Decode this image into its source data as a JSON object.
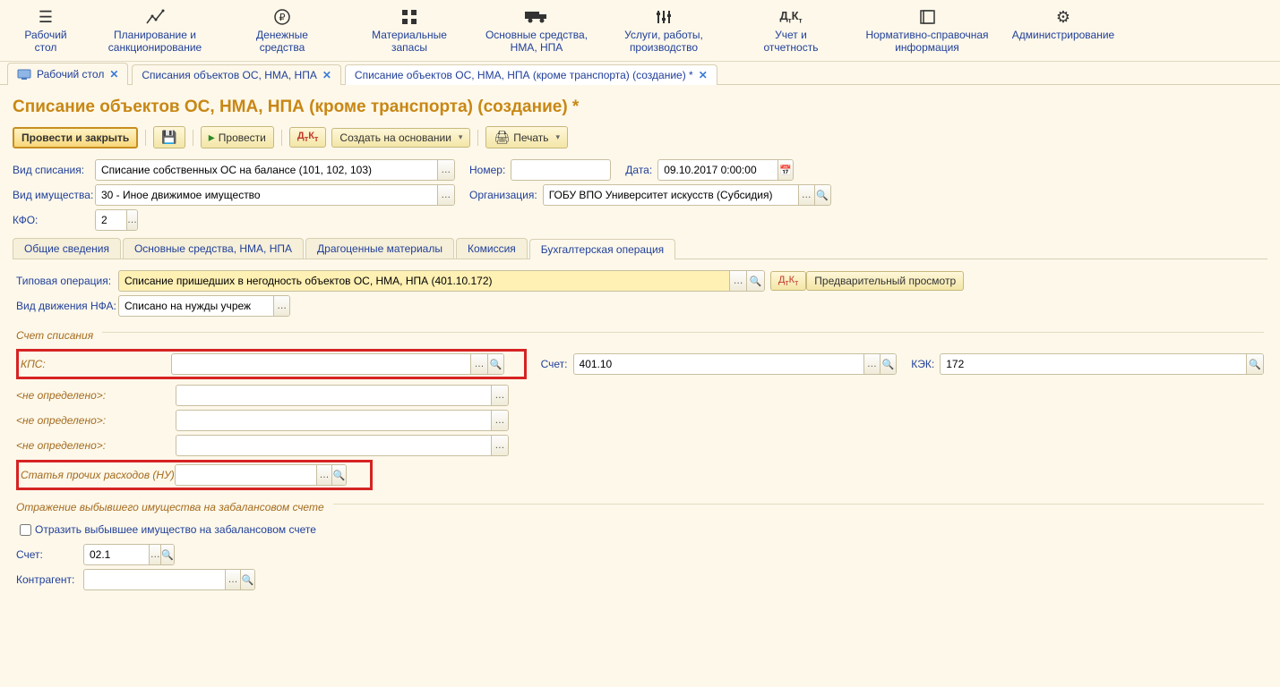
{
  "nav": [
    {
      "label": "Рабочий\nстол"
    },
    {
      "label": "Планирование и\nсанкционирование"
    },
    {
      "label": "Денежные\nсредства"
    },
    {
      "label": "Материальные\nзапасы"
    },
    {
      "label": "Основные средства,\nНМА, НПА"
    },
    {
      "label": "Услуги, работы,\nпроизводство"
    },
    {
      "label": "Учет и\nотчетность"
    },
    {
      "label": "Нормативно-справочная\nинформация"
    },
    {
      "label": "Администрирование"
    }
  ],
  "tabs": [
    {
      "label": "Рабочий стол"
    },
    {
      "label": "Списания объектов ОС, НМА, НПА"
    },
    {
      "label": "Списание объектов ОС, НМА, НПА (кроме транспорта) (создание) *",
      "active": true
    }
  ],
  "page_title": "Списание объектов ОС, НМА, НПА (кроме транспорта) (создание) *",
  "toolbar": {
    "post_close": "Провести и закрыть",
    "post": "Провести",
    "create_on_basis": "Создать на основании",
    "print": "Печать"
  },
  "fields": {
    "type_label": "Вид списания:",
    "type_value": "Списание собственных ОС на балансе (101, 102, 103)",
    "number_label": "Номер:",
    "number_value": "",
    "date_label": "Дата:",
    "date_value": "09.10.2017 0:00:00",
    "property_label": "Вид имущества:",
    "property_value": "30 - Иное движимое имущество",
    "org_label": "Организация:",
    "org_value": "ГОБУ ВПО Университет искусств (Субсидия)",
    "kfo_label": "КФО:",
    "kfo_value": "2"
  },
  "subtabs": [
    "Общие сведения",
    "Основные средства, НМА, НПА",
    "Драгоценные материалы",
    "Комиссия",
    "Бухгалтерская операция"
  ],
  "subtab_active": 4,
  "acc_op": {
    "type_label": "Типовая операция:",
    "type_value": "Списание пришедших в негодность объектов ОС, НМА, НПА (401.10.172)",
    "preview": "Предварительный просмотр",
    "nfa_label": "Вид движения НФА:",
    "nfa_value": "Списано на нужды учреж",
    "fs1_title": "Счет списания",
    "kps_label": "КПС:",
    "kps_value": "",
    "acct_label": "Счет:",
    "acct_value": "401.10",
    "kek_label": "КЭК:",
    "kek_value": "172",
    "nd": "<не определено>:",
    "expense_label": "Статья прочих расходов (НУ):",
    "expense_value": "",
    "fs2_title": "Отражение выбывшего имущества на забалансовом счете",
    "reflect_label": "Отразить выбывшее имущество на забалансовом счете",
    "acct2_label": "Счет:",
    "acct2_value": "02.1",
    "contr_label": "Контрагент:",
    "contr_value": ""
  }
}
